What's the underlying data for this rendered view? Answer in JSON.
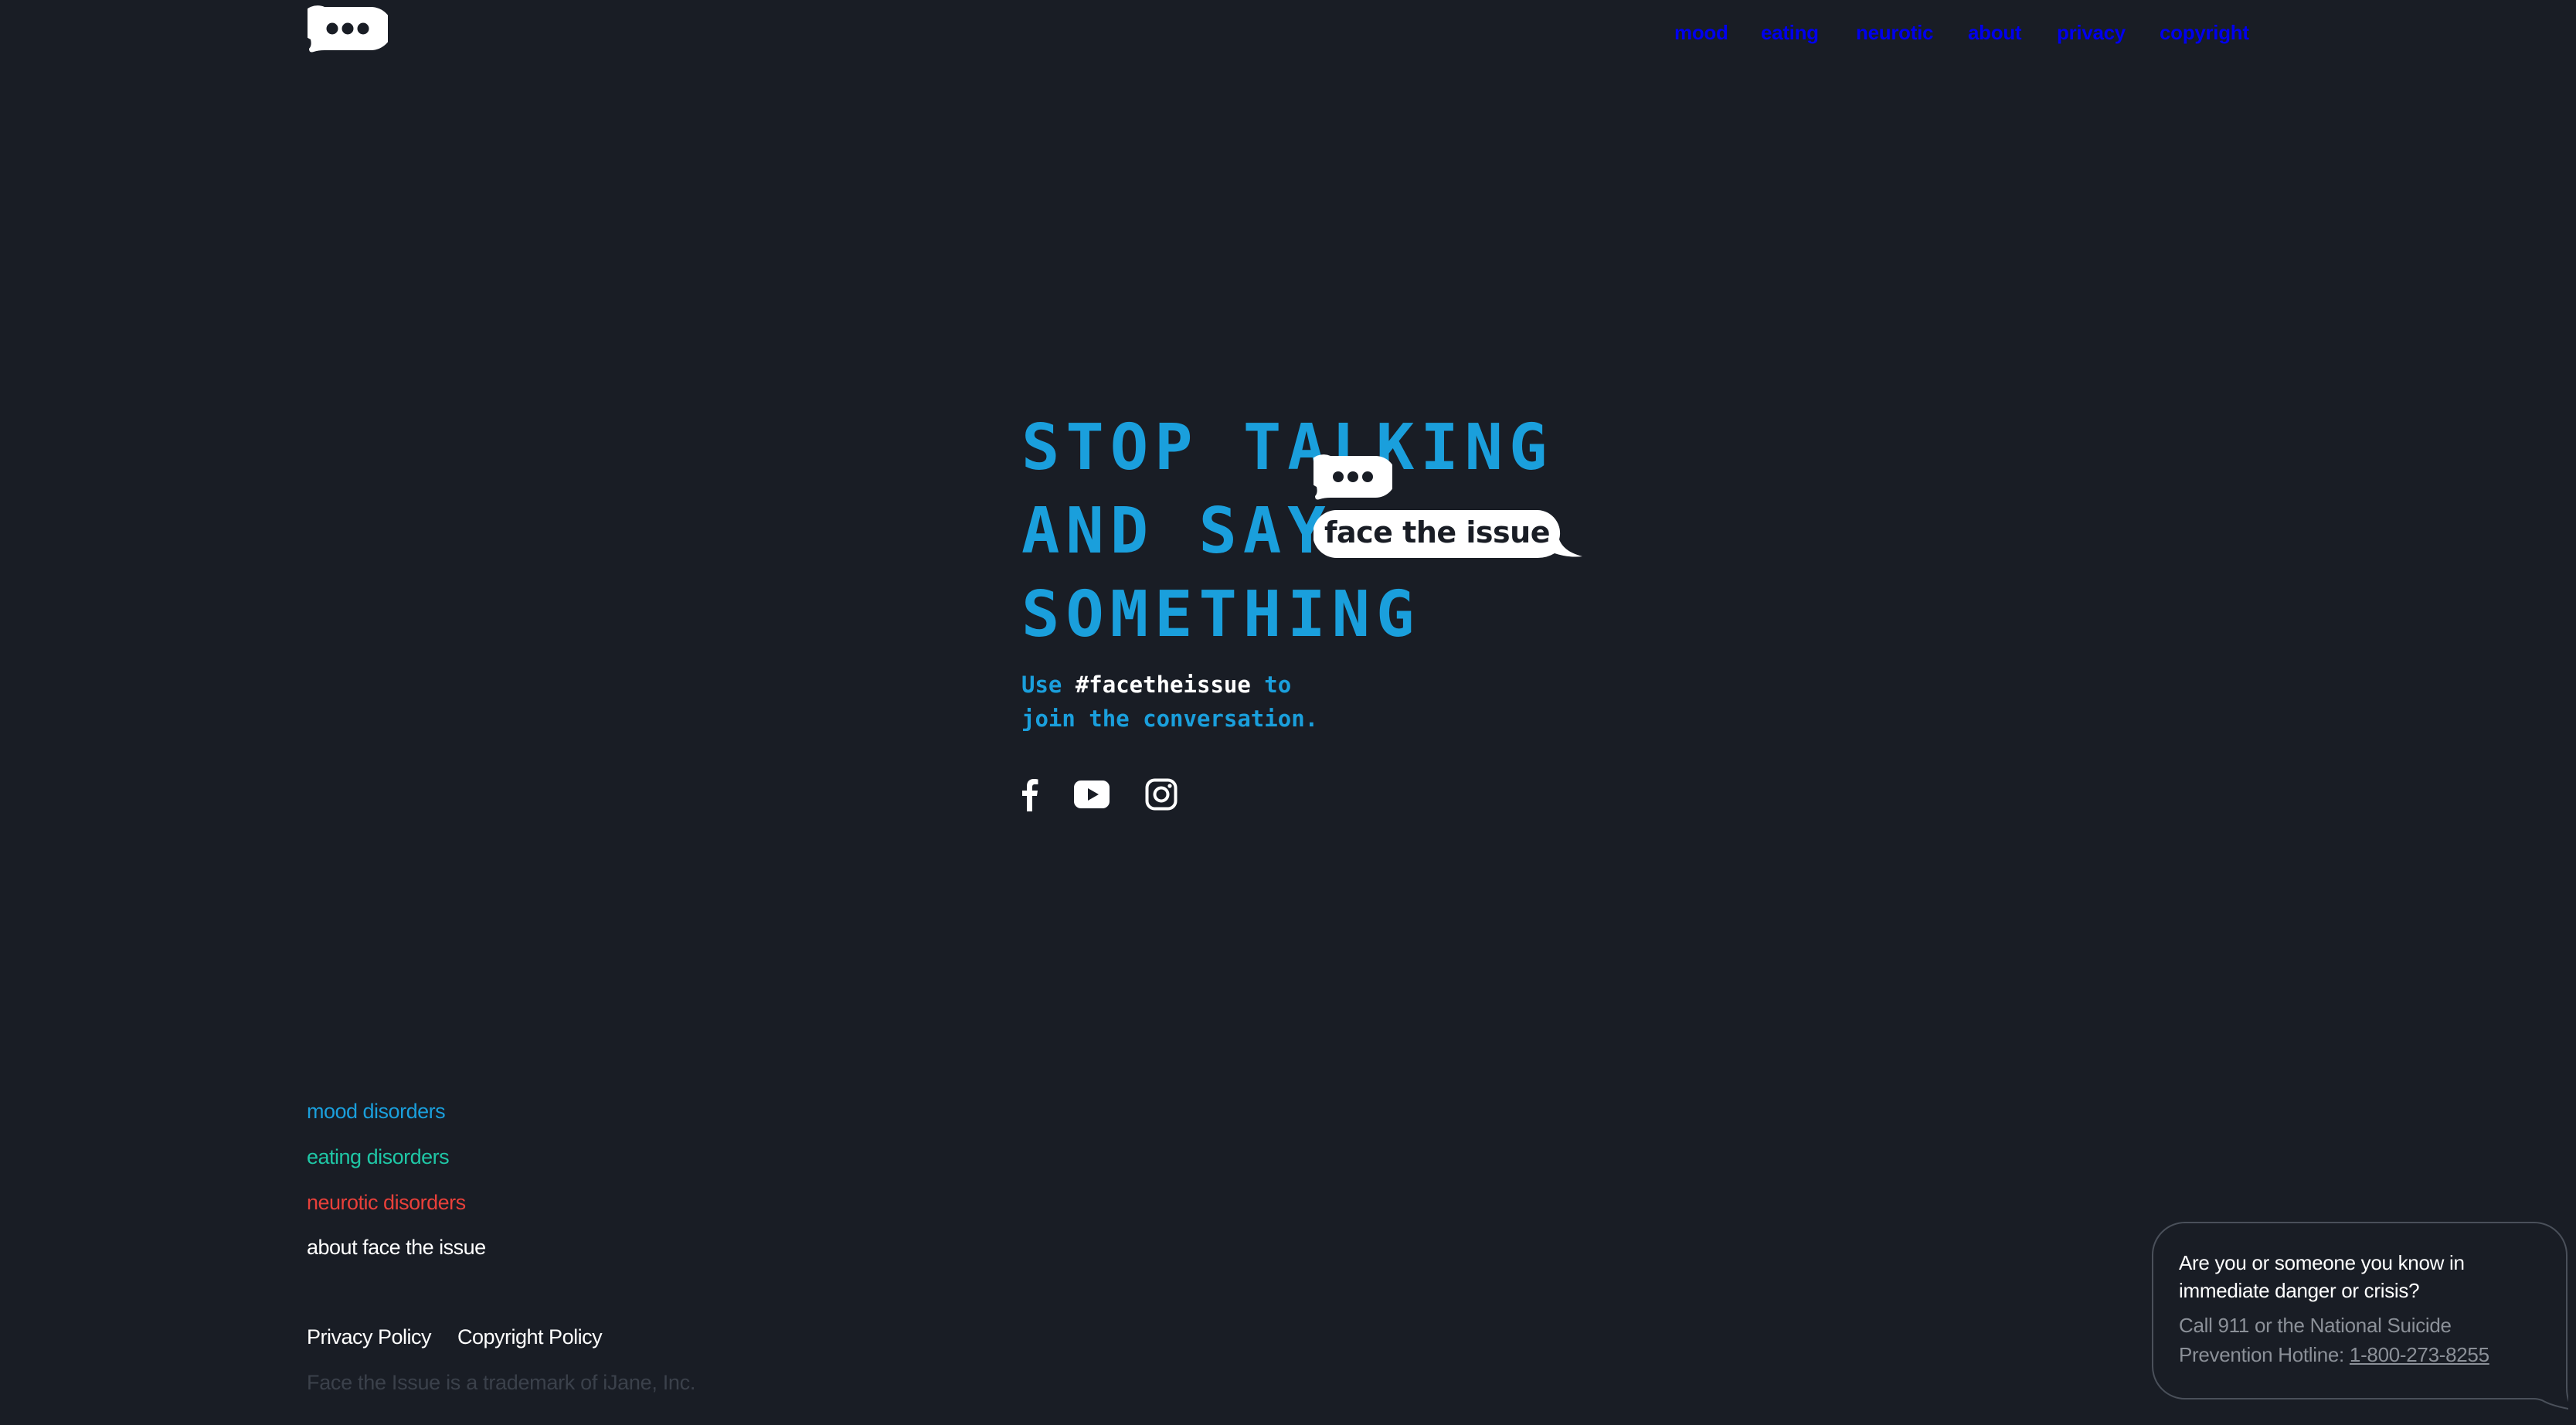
{
  "colors": {
    "background": "#191d25",
    "mood": "#1a9fdc",
    "eating": "#1fc7a6",
    "neurotic": "#e8403a",
    "white": "#ffffff",
    "muted": "#3b414b",
    "crisis_text": "#8b9098"
  },
  "header": {
    "logo_icon": "speech-bubble-dots-icon",
    "nav": [
      {
        "label": "mood",
        "color": "#1a9fdc"
      },
      {
        "label": "eating",
        "color": "#1fc7a6"
      },
      {
        "label": "neurotic",
        "color": "#e8403a"
      },
      {
        "label": "about",
        "color": "#ffffff"
      },
      {
        "label": "privacy",
        "color": "#ffffff"
      },
      {
        "label": "copyright",
        "color": "#ffffff"
      }
    ]
  },
  "hero": {
    "headline": [
      "STOP TALKING",
      "AND SAY",
      "SOMETHING"
    ],
    "bubble_label": "face the issue",
    "tagline_prefix": "Use ",
    "tagline_hashtag": "#facetheissue",
    "tagline_suffix": " to",
    "tagline_line2": "join the conversation.",
    "social": [
      "facebook-icon",
      "youtube-icon",
      "instagram-icon"
    ]
  },
  "footer": {
    "links": [
      {
        "label": "mood disorders",
        "color": "#1a9fdc"
      },
      {
        "label": "eating disorders",
        "color": "#1fc7a6"
      },
      {
        "label": "neurotic disorders",
        "color": "#e8403a"
      },
      {
        "label": "about face the issue",
        "color": "#ffffff"
      }
    ],
    "legal": [
      "Privacy Policy",
      "Copyright Policy"
    ],
    "trademark": "Face the Issue is a trademark of iJane, Inc."
  },
  "crisis": {
    "question": "Are you or someone you know in immediate danger or crisis?",
    "answer_prefix": "Call 911 or the National Suicide Prevention Hotline: ",
    "phone": "1-800-273-8255"
  }
}
